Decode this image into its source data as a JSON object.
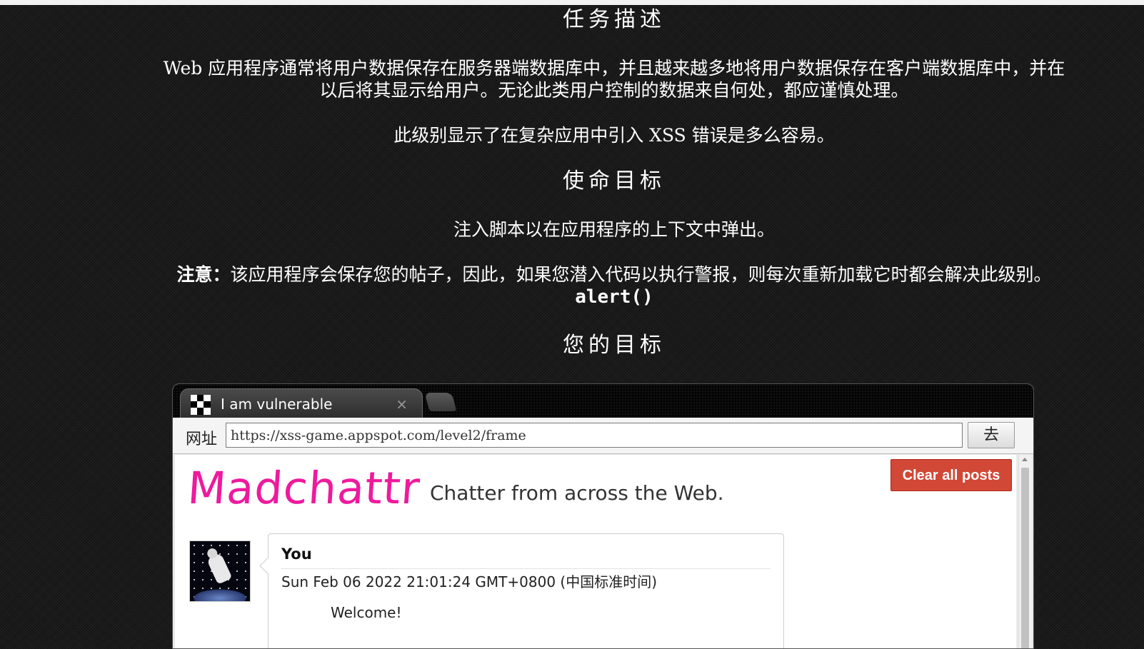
{
  "mission": {
    "heading_description": "任务描述",
    "description_paragraph": "Web 应用程序通常将用户数据保存在服务器端数据库中，并且越来越多地将用户数据保存在客户端数据库中，并在以后将其显示给用户。无论此类用户控制的数据来自何处，都应谨慎处理。",
    "level_paragraph": "此级别显示了在复杂应用中引入 XSS 错误是多么容易。",
    "heading_objective": "使命目标",
    "objective_paragraph": "注入脚本以在应用程序的上下文中弹出。",
    "note_label": "注意：",
    "note_text": "该应用程序会保存您的帖子，因此，如果您潜入代码以执行警报，则每次重新加载它时都会解决此级别。",
    "note_code": "alert()",
    "heading_target": "您的目标"
  },
  "browser": {
    "tab_title": "I am vulnerable",
    "tab_close": "×",
    "url_label": "网址",
    "url_value": "https://xss-game.appspot.com/level2/frame",
    "go_label": "去"
  },
  "app": {
    "logo": "Madchattr",
    "tagline": "Chatter from across the Web.",
    "clear_button": "Clear all posts",
    "logo_color": "#ee1a9d",
    "clear_button_color": "#d14836",
    "posts": [
      {
        "author": "You",
        "date": "Sun Feb 06 2022 21:01:24 GMT+0800 (中国标准时间)",
        "body": "Welcome!"
      }
    ]
  }
}
